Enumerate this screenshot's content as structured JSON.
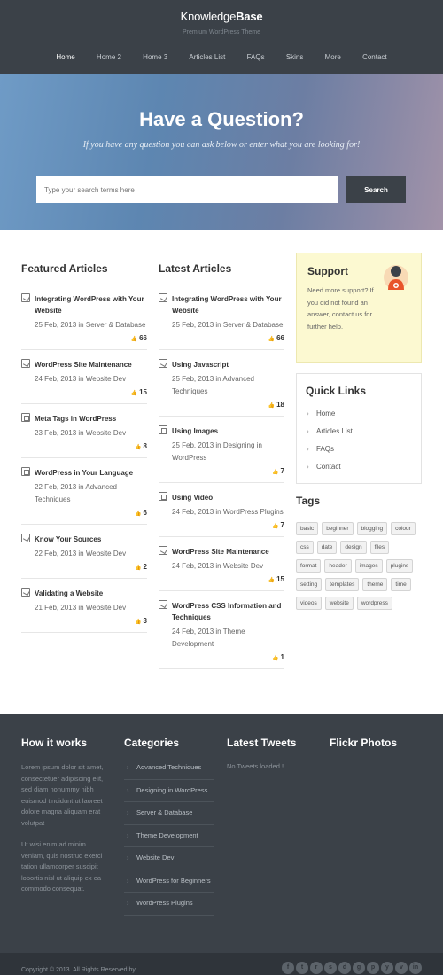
{
  "header": {
    "logo_light": "Knowledge",
    "logo_bold": "Base",
    "tagline": "Premium WordPress Theme",
    "nav": [
      "Home",
      "Home 2",
      "Home 3",
      "Articles List",
      "FAQs",
      "Skins",
      "More",
      "Contact"
    ]
  },
  "hero": {
    "title": "Have a Question?",
    "subtitle": "If you have any question you can ask below or enter what you are looking for!",
    "search_placeholder": "Type your search terms here",
    "search_button": "Search"
  },
  "featured": {
    "title": "Featured Articles",
    "articles": [
      {
        "title": "Integrating WordPress with Your Website",
        "date": "25 Feb, 2013",
        "in": "in",
        "category": "Server & Database",
        "likes": "66"
      },
      {
        "title": "WordPress Site Maintenance",
        "date": "24 Feb, 2013",
        "in": "in",
        "category": "Website Dev",
        "likes": "15"
      },
      {
        "title": "Meta Tags in WordPress",
        "date": "23 Feb, 2013",
        "in": "in",
        "category": "Website Dev",
        "likes": "8"
      },
      {
        "title": "WordPress in Your Language",
        "date": "22 Feb, 2013",
        "in": "in",
        "category": "Advanced Techniques",
        "likes": "6"
      },
      {
        "title": "Know Your Sources",
        "date": "22 Feb, 2013",
        "in": "in",
        "category": "Website Dev",
        "likes": "2"
      },
      {
        "title": "Validating a Website",
        "date": "21 Feb, 2013",
        "in": "in",
        "category": "Website Dev",
        "likes": "3"
      }
    ]
  },
  "latest": {
    "title": "Latest Articles",
    "articles": [
      {
        "title": "Integrating WordPress with Your Website",
        "date": "25 Feb, 2013",
        "in": "in",
        "category": "Server & Database",
        "likes": "66"
      },
      {
        "title": "Using Javascript",
        "date": "25 Feb, 2013",
        "in": "in",
        "category": "Advanced Techniques",
        "likes": "18"
      },
      {
        "title": "Using Images",
        "date": "25 Feb, 2013",
        "in": "in",
        "category": "Designing in WordPress",
        "likes": "7"
      },
      {
        "title": "Using Video",
        "date": "24 Feb, 2013",
        "in": "in",
        "category": "WordPress Plugins",
        "likes": "7"
      },
      {
        "title": "WordPress Site Maintenance",
        "date": "24 Feb, 2013",
        "in": "in",
        "category": "Website Dev",
        "likes": "15"
      },
      {
        "title": "WordPress CSS Information and Techniques",
        "date": "24 Feb, 2013",
        "in": "in",
        "category": "Theme Development",
        "likes": "1"
      }
    ]
  },
  "support": {
    "title": "Support",
    "text": "Need more support? If you did not found an answer, contact us for further help."
  },
  "quick_links": {
    "title": "Quick Links",
    "items": [
      "Home",
      "Articles List",
      "FAQs",
      "Contact"
    ]
  },
  "tags": {
    "title": "Tags",
    "items": [
      "basic",
      "beginner",
      "blogging",
      "colour",
      "css",
      "date",
      "design",
      "files",
      "format",
      "header",
      "images",
      "plugins",
      "setting",
      "templates",
      "theme",
      "time",
      "videos",
      "website",
      "wordpress"
    ]
  },
  "footer": {
    "how_title": "How it works",
    "how_p1": "Lorem ipsum dolor sit amet, consectetuer adipiscing elit, sed diam nonummy nibh euismod tincidunt ut laoreet dolore magna aliquam erat volutpat",
    "how_p2": "Ut wisi enim ad minim veniam, quis nostrud exerci tation ullamcorper suscipit lobortis nisl ut aliquip ex ea commodo consequat.",
    "categories_title": "Categories",
    "categories": [
      "Advanced Techniques",
      "Designing in WordPress",
      "Server & Database",
      "Theme Development",
      "Website Dev",
      "WordPress for Beginners",
      "WordPress Plugins"
    ],
    "tweets_title": "Latest Tweets",
    "tweets_text": "No Tweets loaded !",
    "flickr_title": "Flickr Photos",
    "copyright": "Copyright © 2013. All Rights Reserved by",
    "social_icons": [
      "f",
      "t",
      "r",
      "s",
      "d",
      "g",
      "p",
      "y",
      "v",
      "in"
    ]
  }
}
